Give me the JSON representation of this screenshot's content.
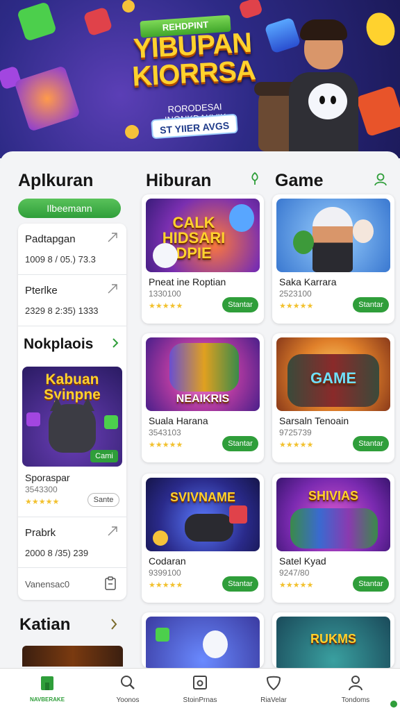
{
  "banner": {
    "ribbon": "REHDPINT",
    "title_line1": "YIBUPAN",
    "title_line2": "KIORRSA",
    "subtitle": "RORODESAI INONKDAKVIK",
    "pill": "ST YIIER AVGS"
  },
  "columns": {
    "left_title": "Aplkuran",
    "mid_title": "Hiburan",
    "right_title": "Game"
  },
  "left": {
    "pill_button": "Ilbeemann",
    "rows": [
      {
        "name": "Padtapgan",
        "stats": "1009     8 / 05.)     73.3"
      },
      {
        "name": "Pterlke",
        "stats": "2329     8 2:35)     1333"
      }
    ],
    "section_title": "Nokplaois",
    "featured": {
      "image_title": "Kabuan Syinpne",
      "chip": "Cami",
      "name": "Sporaspar",
      "number": "3543300",
      "button": "Sante"
    },
    "row3": {
      "name": "Prabrk",
      "stats": "2000     8 /35)     239"
    },
    "footer_label": "Vanensac0"
  },
  "games": [
    {
      "image_text": "CALK HIDSARI DPIE",
      "name": "Pneat ine Roptian",
      "number": "1330100",
      "button": "Stantar"
    },
    {
      "image_text": "",
      "name": "Saka Karrara",
      "number": "2523100",
      "button": "Stantar"
    },
    {
      "image_text": "NEAIKRIS",
      "name": "Suala Harana",
      "number": "3543103",
      "button": "Stantar"
    },
    {
      "image_text": "GAME",
      "name": "Sarsaln Tenoain",
      "number": "9725739",
      "button": "Stantar"
    },
    {
      "image_text": "SVIVNAME",
      "name": "Codaran",
      "number": "9399100",
      "button": "Stantar"
    },
    {
      "image_text": "SHIVIAS",
      "name": "Satel Kyad",
      "number": "9247/80",
      "button": "Stantar"
    },
    {
      "image_text": "",
      "name": "",
      "number": "",
      "button": ""
    },
    {
      "image_text": "RUKMS",
      "name": "",
      "number": "",
      "button": ""
    }
  ],
  "stars": "★★★★★",
  "bottom_section": {
    "title": "Katian"
  },
  "nav": [
    {
      "label": "NAVBERAKE",
      "icon": "home-icon"
    },
    {
      "label": "Yoonos",
      "icon": "search-icon"
    },
    {
      "label": "StoinPrnas",
      "icon": "store-icon"
    },
    {
      "label": "RiaVelar",
      "icon": "shield-icon"
    },
    {
      "label": "Tondoms",
      "icon": "profile-icon"
    }
  ],
  "colors": {
    "accent": "#2f9e3a",
    "star": "#f2c12e"
  }
}
